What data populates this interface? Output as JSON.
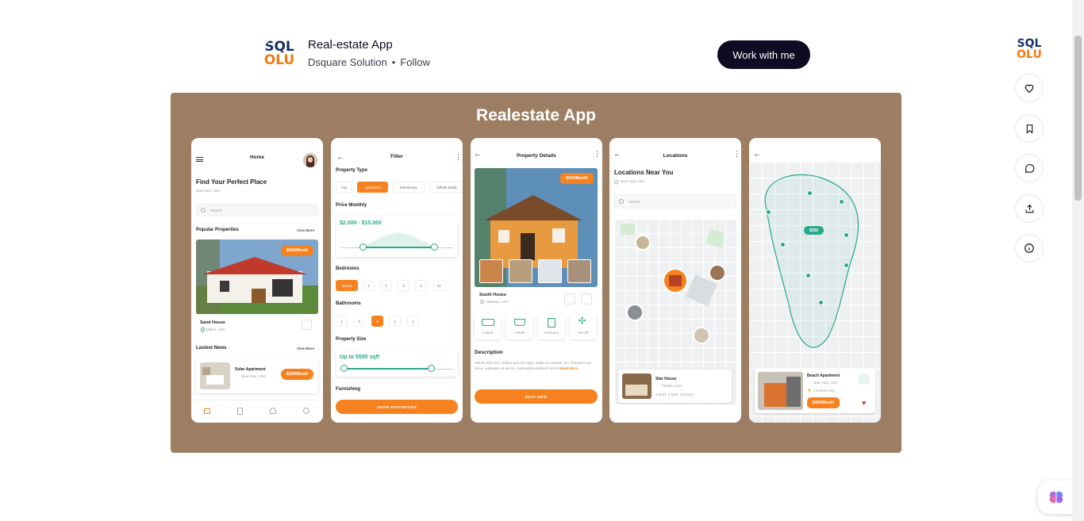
{
  "header": {
    "logo_line1": "SQL",
    "logo_line2": "OLU",
    "shot_title": "Real-estate App",
    "author": "Dsquare Solution",
    "separator": "•",
    "follow_label": "Follow",
    "work_button_label": "Work with me"
  },
  "sidebar_actions": [
    {
      "icon": "heart-icon"
    },
    {
      "icon": "bookmark-icon"
    },
    {
      "icon": "comment-icon"
    },
    {
      "icon": "share-icon"
    },
    {
      "icon": "info-icon"
    }
  ],
  "shot": {
    "title": "Realestate App",
    "phone_home": {
      "title": "Home",
      "heading": "Find Your Perfect Place",
      "location": "New York, USA",
      "search_placeholder": "Search",
      "popular_label": "Popular Properties",
      "view_more": "View More",
      "price_badge": "$360/Month",
      "property_name": "Sand House",
      "property_location": "Miami, USA",
      "news_label": "Lastest News",
      "news_view_more": "View More",
      "news_name": "Solar Apartment",
      "news_location": "New York, USA",
      "news_price": "$290/Month"
    },
    "phone_filter": {
      "title": "Filter",
      "property_type_label": "Property Type",
      "types": [
        "Any",
        "Apartment",
        "Townhouse",
        "Whole Buildi"
      ],
      "price_label": "Price Monthly",
      "price_range": "$2.000 - $15.000",
      "bedrooms_label": "Bedrooms",
      "bedrooms": [
        "Studio",
        "1",
        "2",
        "3",
        "4",
        "5+"
      ],
      "bathrooms_label": "Bathrooms",
      "bathrooms": [
        "1",
        "2",
        "3",
        "4",
        "4"
      ],
      "size_label": "Property Size",
      "size_value": "Up to 5500 sqft",
      "furnishing_label": "Furnishing",
      "show_button": "SHOW PROPERTIES"
    },
    "phone_details": {
      "title": "Property Details",
      "price_badge": "$250/Month",
      "name": "South House",
      "location": "Alabama, USA",
      "features": [
        "4 Beds",
        "3 Bath",
        "6 Rooms",
        "300 M²"
      ],
      "description_label": "Description",
      "description": "Mauris felis erat, finibus quis leo eget, mattis accumsan orci. Praesent est tortor, vulputate eu est ac, malesuada eleifend metus",
      "read_more": "Read More...",
      "rent_button": "RENT NOW"
    },
    "phone_locations": {
      "title": "Locations",
      "heading": "Locations Near You",
      "location": "New York, USA",
      "search_placeholder": "Search",
      "card_name": "Star House",
      "card_location": "Florida, USA",
      "card_features": [
        "2 Beds",
        "2 Bath",
        "3 Rooms"
      ]
    },
    "phone_map": {
      "map_price": "$250",
      "card_name": "Beach Apartment",
      "card_location": "New York, USA",
      "card_rating": "4.9 (from 231)",
      "card_price": "$450/Month"
    }
  }
}
